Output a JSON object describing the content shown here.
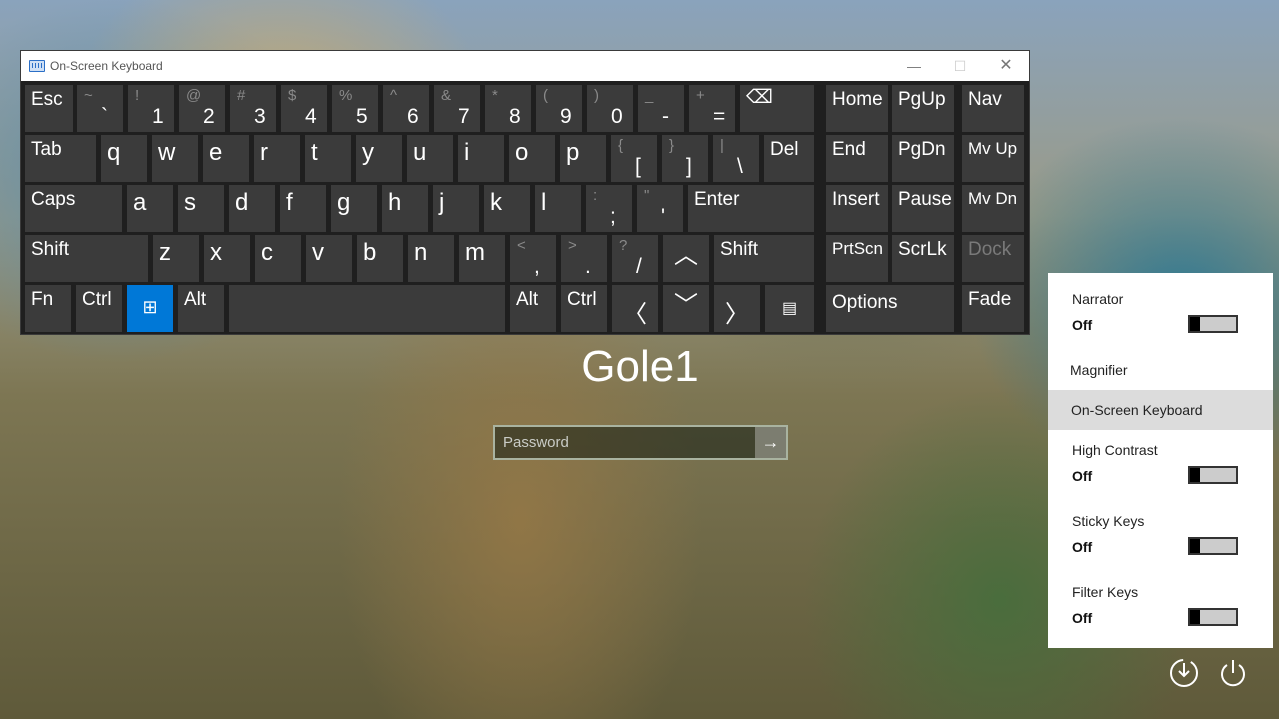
{
  "window": {
    "title": "On-Screen Keyboard",
    "min": "—",
    "max": "☐",
    "close": "✕"
  },
  "keys": {
    "esc": "Esc",
    "tilde_shift": "~",
    "tilde_main": "`",
    "n1s": "!",
    "n1": "1",
    "n2s": "@",
    "n2": "2",
    "n3s": "#",
    "n3": "3",
    "n4s": "$",
    "n4": "4",
    "n5s": "%",
    "n5": "5",
    "n6s": "^",
    "n6": "6",
    "n7s": "&",
    "n7": "7",
    "n8s": "*",
    "n8": "8",
    "n9s": "(",
    "n9": "9",
    "n0s": ")",
    "n0": "0",
    "minus_s": "_",
    "minus": "-",
    "eq_s": "+",
    "eq": "=",
    "backspace": "⌫",
    "home": "Home",
    "pgup": "PgUp",
    "nav": "Nav",
    "tab": "Tab",
    "q": "q",
    "w": "w",
    "e": "e",
    "r": "r",
    "t": "t",
    "y": "y",
    "u": "u",
    "i": "i",
    "o": "o",
    "p": "p",
    "lbr_s": "{",
    "lbr": "[",
    "rbr_s": "}",
    "rbr": "]",
    "bsl_s": "|",
    "bsl": "\\",
    "del": "Del",
    "end": "End",
    "pgdn": "PgDn",
    "mvup": "Mv Up",
    "caps": "Caps",
    "a": "a",
    "s": "s",
    "d": "d",
    "f": "f",
    "g": "g",
    "h": "h",
    "j": "j",
    "k": "k",
    "l": "l",
    "semi_s": ":",
    "semi": ";",
    "quot_s": "\"",
    "quot": "'",
    "enter": "Enter",
    "insert": "Insert",
    "pause": "Pause",
    "mvdn": "Mv Dn",
    "shift": "Shift",
    "z": "z",
    "x": "x",
    "c": "c",
    "v": "v",
    "b": "b",
    "n": "n",
    "m": "m",
    "comma_s": "<",
    "comma": ",",
    "period_s": ">",
    "period": ".",
    "slash_s": "?",
    "slash": "/",
    "up": "︿",
    "prtscn": "PrtScn",
    "scrlk": "ScrLk",
    "dock": "Dock",
    "fn": "Fn",
    "ctrl": "Ctrl",
    "win": "⊞",
    "alt": "Alt",
    "left": "〈",
    "down": "﹀",
    "right": "〉",
    "menu": "▤",
    "options": "Options",
    "fade": "Fade"
  },
  "login": {
    "username": "Gole1",
    "password_placeholder": "Password",
    "submit_arrow": "→"
  },
  "ease_panel": {
    "narrator": {
      "name": "Narrator",
      "state": "Off"
    },
    "magnifier": {
      "name": "Magnifier"
    },
    "osk": {
      "name": "On-Screen Keyboard"
    },
    "high_contrast": {
      "name": "High Contrast",
      "state": "Off"
    },
    "sticky_keys": {
      "name": "Sticky Keys",
      "state": "Off"
    },
    "filter_keys": {
      "name": "Filter Keys",
      "state": "Off"
    }
  },
  "icons": {
    "ease_of_access": "ease-of-access-icon",
    "power": "power-icon"
  },
  "colors": {
    "win_key": "#0078d7",
    "key_bg": "#3b3b3b",
    "osk_bg": "#1f1f1f"
  }
}
